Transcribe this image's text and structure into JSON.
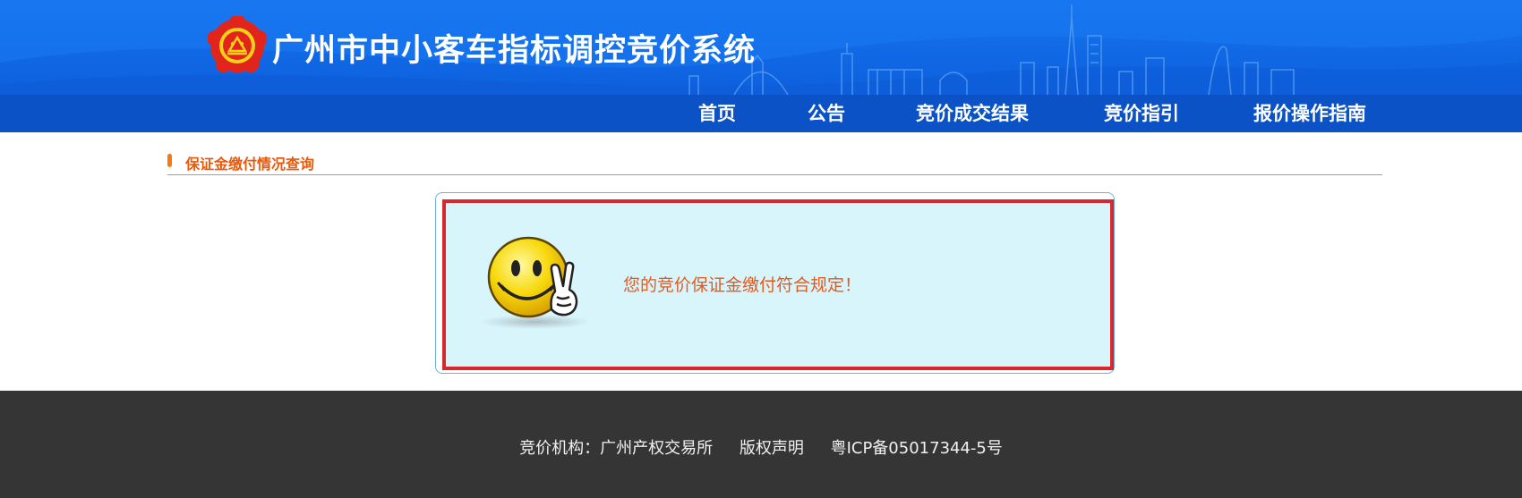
{
  "header": {
    "title": "广州市中小客车指标调控竞价系统",
    "logo_icon": "emblem-icon"
  },
  "nav": {
    "items": [
      {
        "label": "首页"
      },
      {
        "label": "公告"
      },
      {
        "label": "竞价成交结果"
      },
      {
        "label": "竞价指引"
      },
      {
        "label": "报价操作指南"
      }
    ]
  },
  "section": {
    "title": "保证金缴付情况查询"
  },
  "result": {
    "message": "您的竞价保证金缴付符合规定！",
    "icon": "smiley-victory-icon"
  },
  "footer": {
    "org_label": "竞价机构：广州产权交易所",
    "copyright_label": "版权声明",
    "icp_label": "粤ICP备05017344-5号"
  },
  "colors": {
    "header_blue": "#1673ee",
    "nav_blue": "#0b52c6",
    "accent_orange": "#e8590c",
    "result_border_red": "#d7282f",
    "result_bg": "#d8f5fc",
    "footer_bg": "#353535"
  }
}
